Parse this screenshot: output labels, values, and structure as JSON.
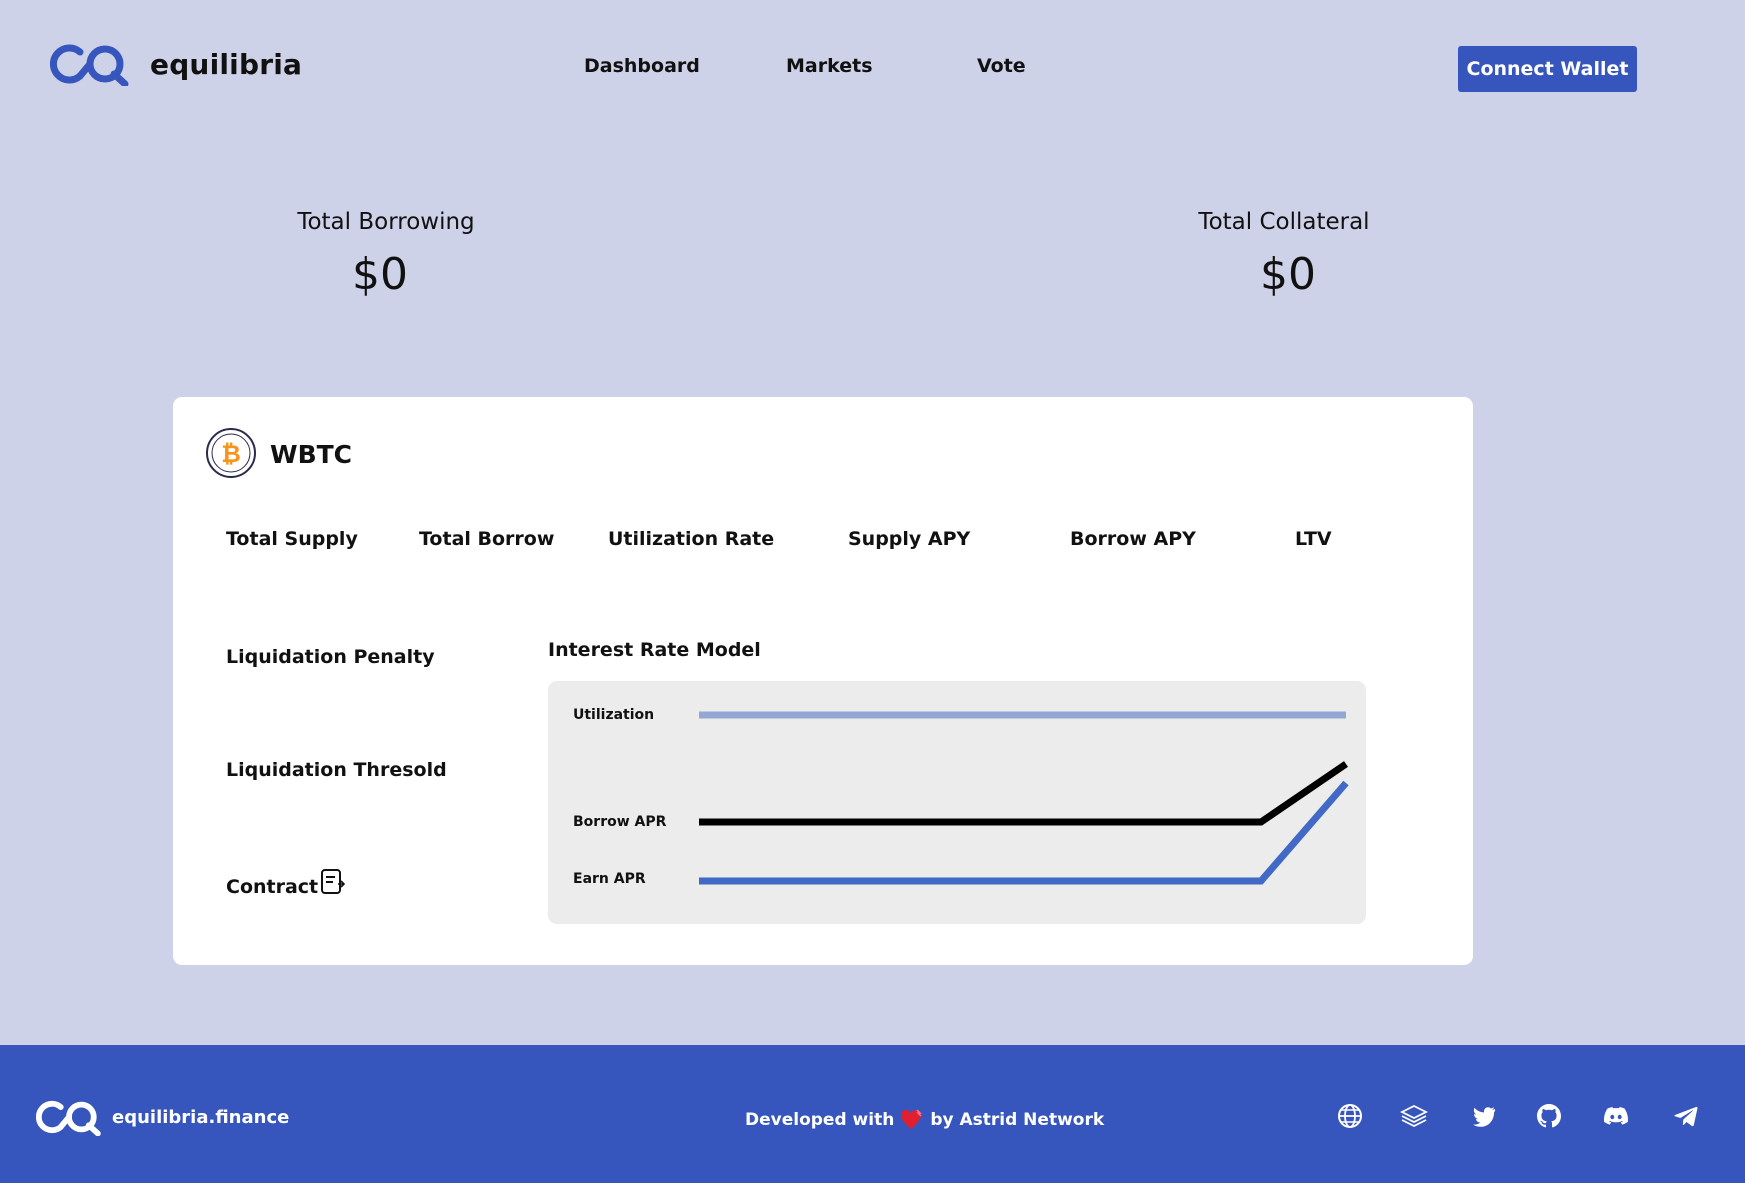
{
  "header": {
    "brand": "equilibria",
    "nav": [
      "Dashboard",
      "Markets",
      "Vote"
    ],
    "connect_label": "Connect Wallet"
  },
  "totals": {
    "borrowing_label": "Total Borrowing",
    "borrowing_value": "$0",
    "collateral_label": "Total Collateral",
    "collateral_value": "$0"
  },
  "asset": {
    "name": "WBTC",
    "metrics": [
      "Total Supply",
      "Total Borrow",
      "Utilization Rate",
      "Supply APY",
      "Borrow APY",
      "LTV"
    ],
    "liquidation_penalty_label": "Liquidation Penalty",
    "liquidation_threshold_label": "Liquidation Thresold",
    "contract_label": "Contract"
  },
  "interest_rate_model": {
    "title": "Interest Rate Model",
    "labels": {
      "utilization": "Utilization",
      "borrow": "Borrow APR",
      "earn": "Earn APR"
    },
    "colors": {
      "utilization": "#94a6d4",
      "borrow": "#000000",
      "earn": "#4169c5"
    }
  },
  "footer": {
    "brand": "equilibria.finance",
    "dev_prefix": "Developed with",
    "dev_suffix": "by Astrid Network",
    "socials": [
      "globe-icon",
      "layers-icon",
      "twitter-icon",
      "github-icon",
      "discord-icon",
      "telegram-icon"
    ]
  },
  "colors": {
    "background": "#ced2e8",
    "primary": "#3656bd",
    "bitcoin": "#f7931a"
  }
}
